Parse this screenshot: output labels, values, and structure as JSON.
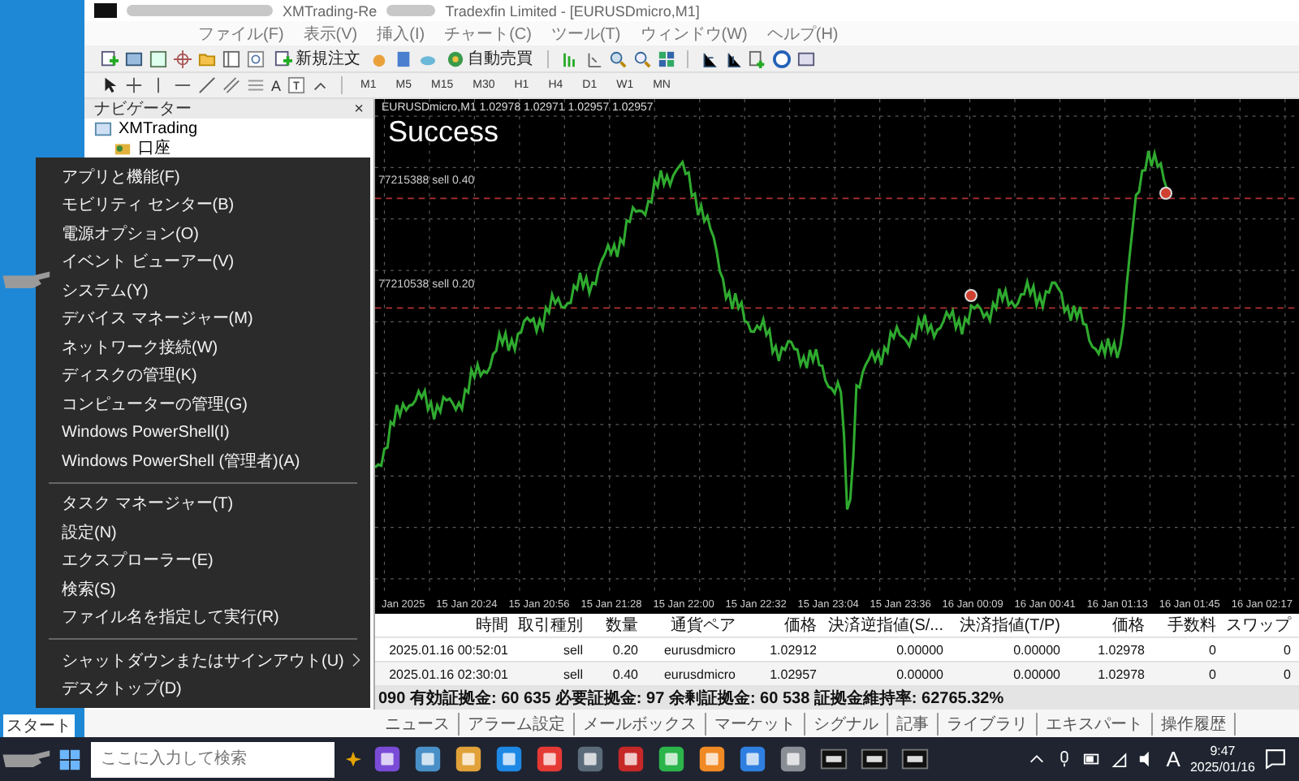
{
  "window": {
    "title_left": "XMTrading-Re",
    "title_right": "Tradexfin Limited - [EURUSDmicro,M1]"
  },
  "menu_bar": [
    "ファイル(F)",
    "表示(V)",
    "挿入(I)",
    "チャート(C)",
    "ツール(T)",
    "ウィンドウ(W)",
    "ヘルプ(H)"
  ],
  "toolbar": {
    "new_order": "新規注文",
    "auto_trading": "自動売買",
    "text_tool": "A"
  },
  "timeframes": [
    "M1",
    "M5",
    "M15",
    "M30",
    "H1",
    "H4",
    "D1",
    "W1",
    "MN"
  ],
  "navigator": {
    "title": "ナビゲーター",
    "close": "×",
    "items": [
      {
        "label": "XMTrading",
        "children": [
          {
            "label": "口座"
          }
        ]
      }
    ]
  },
  "chart": {
    "header": "EURUSDmicro,M1 1.02978 1.02971 1.02957 1.02957",
    "overlay": "Success",
    "order_lines": [
      {
        "label": "77215388 sell 0.40"
      },
      {
        "label": "77210538 sell 0.20"
      }
    ],
    "time_labels": [
      "Jan 2025",
      "15 Jan 20:24",
      "15 Jan 20:56",
      "15 Jan 21:28",
      "15 Jan 22:00",
      "15 Jan 22:32",
      "15 Jan 23:04",
      "15 Jan 23:36",
      "16 Jan 00:09",
      "16 Jan 00:41",
      "16 Jan 01:13",
      "16 Jan 01:45",
      "16 Jan 02:17"
    ]
  },
  "orders_table": {
    "columns": [
      "時間",
      "取引種別",
      "数量",
      "通貨ペア",
      "価格",
      "決済逆指値(S/...",
      "決済指値(T/P)",
      "価格",
      "手数料",
      "スワップ"
    ],
    "rows": [
      [
        "2025.01.16 00:52:01",
        "sell",
        "0.20",
        "eurusdmicro",
        "1.02912",
        "0.00000",
        "0.00000",
        "1.02978",
        "0",
        "0"
      ],
      [
        "2025.01.16 02:30:01",
        "sell",
        "0.40",
        "eurusdmicro",
        "1.02957",
        "0.00000",
        "0.00000",
        "1.02978",
        "0",
        "0"
      ]
    ],
    "status": "090 有効証拠金: 60 635 必要証拠金: 97 余剰証拠金: 60 538 証拠金維持率: 62765.32%"
  },
  "terminal_tabs": [
    "ニュース",
    "アラーム設定",
    "メールボックス",
    "マーケット",
    "シグナル",
    "記事",
    "ライブラリ",
    "エキスパート",
    "操作履歴"
  ],
  "context_menu": {
    "groups": [
      [
        {
          "label": "アプリと機能(F)",
          "submenu": false
        },
        {
          "label": "モビリティ センター(B)",
          "submenu": false
        },
        {
          "label": "電源オプション(O)",
          "submenu": false
        },
        {
          "label": "イベント ビューアー(V)",
          "submenu": false
        },
        {
          "label": "システム(Y)",
          "submenu": false
        },
        {
          "label": "デバイス マネージャー(M)",
          "submenu": false
        },
        {
          "label": "ネットワーク接続(W)",
          "submenu": false
        },
        {
          "label": "ディスクの管理(K)",
          "submenu": false
        },
        {
          "label": "コンピューターの管理(G)",
          "submenu": false
        },
        {
          "label": "Windows PowerShell(I)",
          "submenu": false
        },
        {
          "label": "Windows PowerShell (管理者)(A)",
          "submenu": false
        }
      ],
      [
        {
          "label": "タスク マネージャー(T)",
          "submenu": false
        },
        {
          "label": "設定(N)",
          "submenu": false
        },
        {
          "label": "エクスプローラー(E)",
          "submenu": false
        },
        {
          "label": "検索(S)",
          "submenu": false
        },
        {
          "label": "ファイル名を指定して実行(R)",
          "submenu": false
        }
      ],
      [
        {
          "label": "シャットダウンまたはサインアウト(U)",
          "submenu": true
        },
        {
          "label": "デスクトップ(D)",
          "submenu": false
        }
      ]
    ]
  },
  "start_tooltip": "スタート",
  "taskbar": {
    "search_placeholder": "ここに入力して検索",
    "ime": "A",
    "time": "9:47",
    "date": "2025/01/16"
  }
}
